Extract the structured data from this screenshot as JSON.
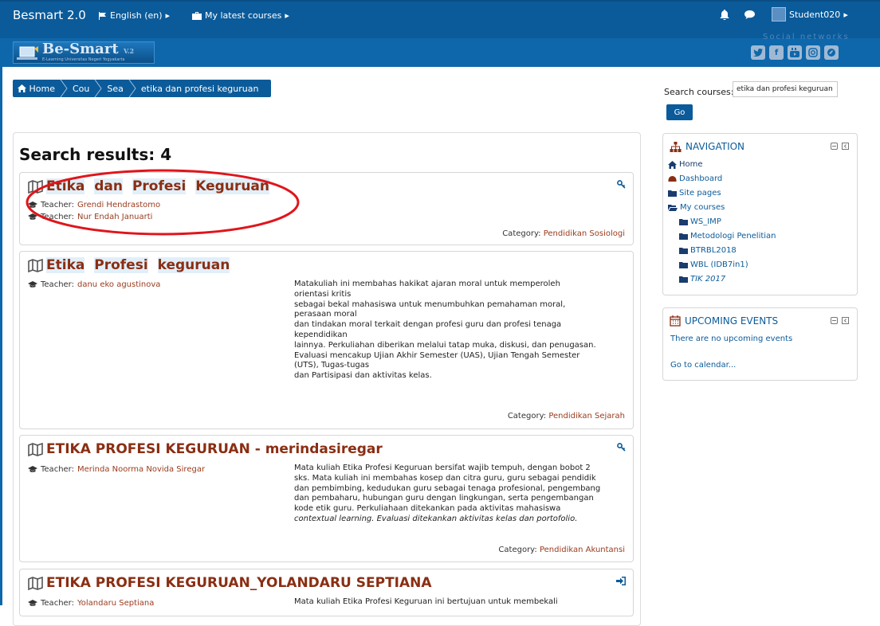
{
  "navbar": {
    "brand": "Besmart 2.0",
    "language": "English (en)",
    "my_courses": "My latest courses",
    "user": "Student020"
  },
  "banner": {
    "logo_title": "Be-Smart",
    "logo_version": "V.2",
    "logo_subtitle": "E-Learning Universitas Negeri Yogyakarta",
    "social_label": "Social networks"
  },
  "breadcrumb": [
    "Home",
    "Cou",
    "Sea",
    "etika dan profesi keguruan"
  ],
  "results_title": "Search results: 4",
  "labels": {
    "teacher": "Teacher:",
    "category": "Category:"
  },
  "courses": [
    {
      "title_parts": [
        "Etika",
        "dan",
        "Profesi",
        "Keguruan"
      ],
      "teachers": [
        "Grendi Hendrastomo",
        "Nur Endah Januarti"
      ],
      "category": "Pendidikan Sosiologi"
    },
    {
      "title_parts": [
        "Etika",
        "Profesi",
        "keguruan"
      ],
      "teachers": [
        "danu eko agustinova"
      ],
      "summary_lines": [
        "Matakuliah ini membahas hakikat ajaran moral untuk memperoleh",
        "orientasi  kritis",
        "sebagai bekal mahasiswa untuk menumbuhkan pemahaman moral,",
        "perasaan  moral",
        "dan tindakan moral terkait dengan profesi guru dan profesi tenaga",
        "kependidikan",
        "lainnya. Perkuliahan diberikan melalui tatap muka,  diskusi, dan penugasan.",
        "Evaluasi  mencakup Ujian Akhir Semester (UAS), Ujian Tengah Semester",
        "(UTS), Tugas-tugas",
        "dan Partisipasi dan aktivitas kelas."
      ],
      "category": "Pendidikan Sejarah"
    },
    {
      "title": "ETIKA PROFESI KEGURUAN - merindasiregar",
      "teachers": [
        "Merinda Noorma Novida Siregar"
      ],
      "summary_lines": [
        "Mata kuliah Etika Profesi Keguruan bersifat wajib tempuh, dengan bobot 2",
        "sks. Mata kuliah ini membahas kosep dan citra guru, guru sebagai pendidik",
        "dan pembimbing, kedudukan guru sebagai tenaga profesional, pengembang",
        "dan pembaharu, hubungan guru dengan lingkungan, serta pengembangan",
        "kode etik guru. Perkuliahaan ditekankan pada aktivitas mahasiswa",
        "contextual learning. Evaluasi ditekankan aktivitas kelas dan portofolio."
      ],
      "category": "Pendidikan Akuntansi"
    },
    {
      "title": "ETIKA PROFESI KEGURUAN_YOLANDARU SEPTIANA",
      "teachers": [
        "Yolandaru Septiana"
      ],
      "summary_lines": [
        "Mata kuliah Etika Profesi Keguruan ini bertujuan untuk membekali"
      ]
    }
  ],
  "search": {
    "label": "Search courses:",
    "value": "etika dan profesi keguruan",
    "go": "Go"
  },
  "navigation": {
    "title": "NAVIGATION",
    "items": [
      "Home",
      "Dashboard",
      "Site pages",
      "My courses"
    ],
    "my_courses": [
      "WS_IMP",
      "Metodologi Penelitian",
      "BTRBL2018",
      "WBL (IDB7in1)",
      "TIK 2017"
    ]
  },
  "events": {
    "title": "UPCOMING EVENTS",
    "empty_text": "There are no upcoming events",
    "calendar_link": "Go to calendar..."
  },
  "colors": {
    "navbar": "#0b5b9a",
    "banner": "#0e67aa",
    "course_title": "#8a2e13",
    "annotation": "#e0151b"
  }
}
